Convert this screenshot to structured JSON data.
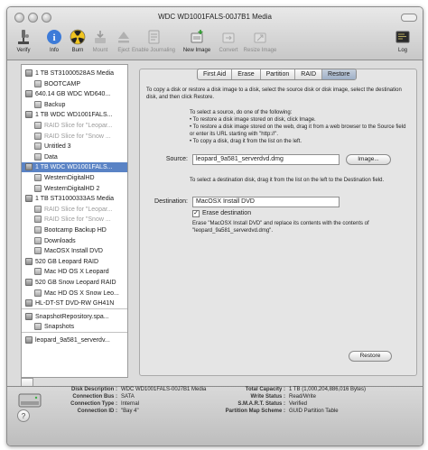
{
  "window": {
    "title": "WDC WD1001FALS-00J7B1 Media"
  },
  "toolbar": {
    "items": [
      {
        "label": "Verify",
        "icon": "microscope-icon",
        "enabled": true
      },
      {
        "label": "Info",
        "icon": "info-icon",
        "enabled": true
      },
      {
        "label": "Burn",
        "icon": "burn-icon",
        "enabled": true
      },
      {
        "label": "Mount",
        "icon": "mount-icon",
        "enabled": false
      },
      {
        "label": "Eject",
        "icon": "eject-icon",
        "enabled": false
      },
      {
        "label": "Enable Journaling",
        "icon": "journal-icon",
        "enabled": false
      },
      {
        "label": "New Image",
        "icon": "new-image-icon",
        "enabled": true
      },
      {
        "label": "Convert",
        "icon": "convert-icon",
        "enabled": false
      },
      {
        "label": "Resize Image",
        "icon": "resize-image-icon",
        "enabled": false
      }
    ],
    "log_label": "Log"
  },
  "sidebar": {
    "items": [
      {
        "label": "1 TB ST31000528AS Media",
        "kind": "disk",
        "indent": 0,
        "gray": false,
        "selected": false
      },
      {
        "label": "BOOTCAMP",
        "kind": "volume",
        "indent": 1,
        "gray": false,
        "selected": false
      },
      {
        "label": "640.14 GB WDC WD640...",
        "kind": "disk",
        "indent": 0,
        "gray": false,
        "selected": false
      },
      {
        "label": "Backup",
        "kind": "volume",
        "indent": 1,
        "gray": false,
        "selected": false
      },
      {
        "label": "1 TB WDC WD1001FALS...",
        "kind": "disk",
        "indent": 0,
        "gray": false,
        "selected": false
      },
      {
        "label": "RAID Slice for \"Leopar...",
        "kind": "volume",
        "indent": 1,
        "gray": true,
        "selected": false
      },
      {
        "label": "RAID Slice for \"Snow ...",
        "kind": "volume",
        "indent": 1,
        "gray": true,
        "selected": false
      },
      {
        "label": "Untitled 3",
        "kind": "volume",
        "indent": 1,
        "gray": false,
        "selected": false
      },
      {
        "label": "Data",
        "kind": "volume",
        "indent": 1,
        "gray": false,
        "selected": false
      },
      {
        "label": "1 TB WDC WD1001FALS...",
        "kind": "disk",
        "indent": 0,
        "gray": false,
        "selected": true
      },
      {
        "label": "WesternDigitalHD",
        "kind": "volume",
        "indent": 1,
        "gray": false,
        "selected": false
      },
      {
        "label": "WesternDigitalHD 2",
        "kind": "volume",
        "indent": 1,
        "gray": false,
        "selected": false
      },
      {
        "label": "1 TB ST31000333AS Media",
        "kind": "disk",
        "indent": 0,
        "gray": false,
        "selected": false
      },
      {
        "label": "RAID Slice for \"Leopar...",
        "kind": "volume",
        "indent": 1,
        "gray": true,
        "selected": false
      },
      {
        "label": "RAID Slice for \"Snow ...",
        "kind": "volume",
        "indent": 1,
        "gray": true,
        "selected": false
      },
      {
        "label": "Bootcamp Backup HD",
        "kind": "volume",
        "indent": 1,
        "gray": false,
        "selected": false
      },
      {
        "label": "Downloads",
        "kind": "volume",
        "indent": 1,
        "gray": false,
        "selected": false
      },
      {
        "label": "MacOSX Install DVD",
        "kind": "volume",
        "indent": 1,
        "gray": false,
        "selected": false
      },
      {
        "label": "520 GB Leopard RAID",
        "kind": "disk",
        "indent": 0,
        "gray": false,
        "selected": false
      },
      {
        "label": "Mac HD OS X Leopard",
        "kind": "volume",
        "indent": 1,
        "gray": false,
        "selected": false
      },
      {
        "label": "520 GB Snow Leopard RAID",
        "kind": "disk",
        "indent": 0,
        "gray": false,
        "selected": false
      },
      {
        "label": "Mac HD OS X Snow Leo...",
        "kind": "volume",
        "indent": 1,
        "gray": false,
        "selected": false
      },
      {
        "label": "HL-DT-ST DVD-RW GH41N",
        "kind": "optical",
        "indent": 0,
        "gray": false,
        "selected": false
      },
      {
        "label": "SnapshotRepository.spa...",
        "kind": "image",
        "indent": 0,
        "gray": false,
        "selected": false
      },
      {
        "label": "Snapshots",
        "kind": "volume",
        "indent": 1,
        "gray": false,
        "selected": false
      },
      {
        "label": "leopard_9a581_serverdv...",
        "kind": "image",
        "indent": 0,
        "gray": false,
        "selected": false
      }
    ]
  },
  "tabs": [
    {
      "label": "First Aid",
      "active": false
    },
    {
      "label": "Erase",
      "active": false
    },
    {
      "label": "Partition",
      "active": false
    },
    {
      "label": "RAID",
      "active": false
    },
    {
      "label": "Restore",
      "active": true
    }
  ],
  "restore": {
    "intro": "To copy a disk or restore a disk image to a disk, select the source disk or disk image, select the destination disk, and then click Restore.",
    "source_help_title": "To select a source, do one of the following:",
    "source_help_1": "• To restore a disk image stored on disk, click Image.",
    "source_help_2": "• To restore a disk image stored on the web, drag it from a web browser to the Source field or enter its URL starting with \"http://\".",
    "source_help_3": "• To copy a disk, drag it from the list on the left.",
    "source_label": "Source:",
    "source_value": "leopard_9a581_serverdvd.dmg",
    "image_button": "Image...",
    "dest_help": "To select a destination disk, drag it from the list on the left to the Destination field.",
    "dest_label": "Destination:",
    "dest_value": "MacOSX Install DVD",
    "erase_label": "Erase destination",
    "erase_checked": true,
    "erase_note": "Erase \"MacOSX Install DVD\" and replace its contents with the contents of \"leopard_9a581_serverdvd.dmg\".",
    "restore_button": "Restore"
  },
  "info": {
    "left": [
      {
        "key": "Disk Description :",
        "value": "WDC WD1001FALS-00J7B1 Media"
      },
      {
        "key": "Connection Bus :",
        "value": "SATA"
      },
      {
        "key": "Connection Type :",
        "value": "Internal"
      },
      {
        "key": "Connection ID :",
        "value": "\"Bay 4\""
      }
    ],
    "right": [
      {
        "key": "Total Capacity :",
        "value": "1 TB (1,000,204,886,016 Bytes)"
      },
      {
        "key": "Write Status :",
        "value": "Read/Write"
      },
      {
        "key": "S.M.A.R.T. Status :",
        "value": "Verified"
      },
      {
        "key": "Partition Map Scheme :",
        "value": "GUID Partition Table"
      }
    ],
    "help_label": "?"
  }
}
